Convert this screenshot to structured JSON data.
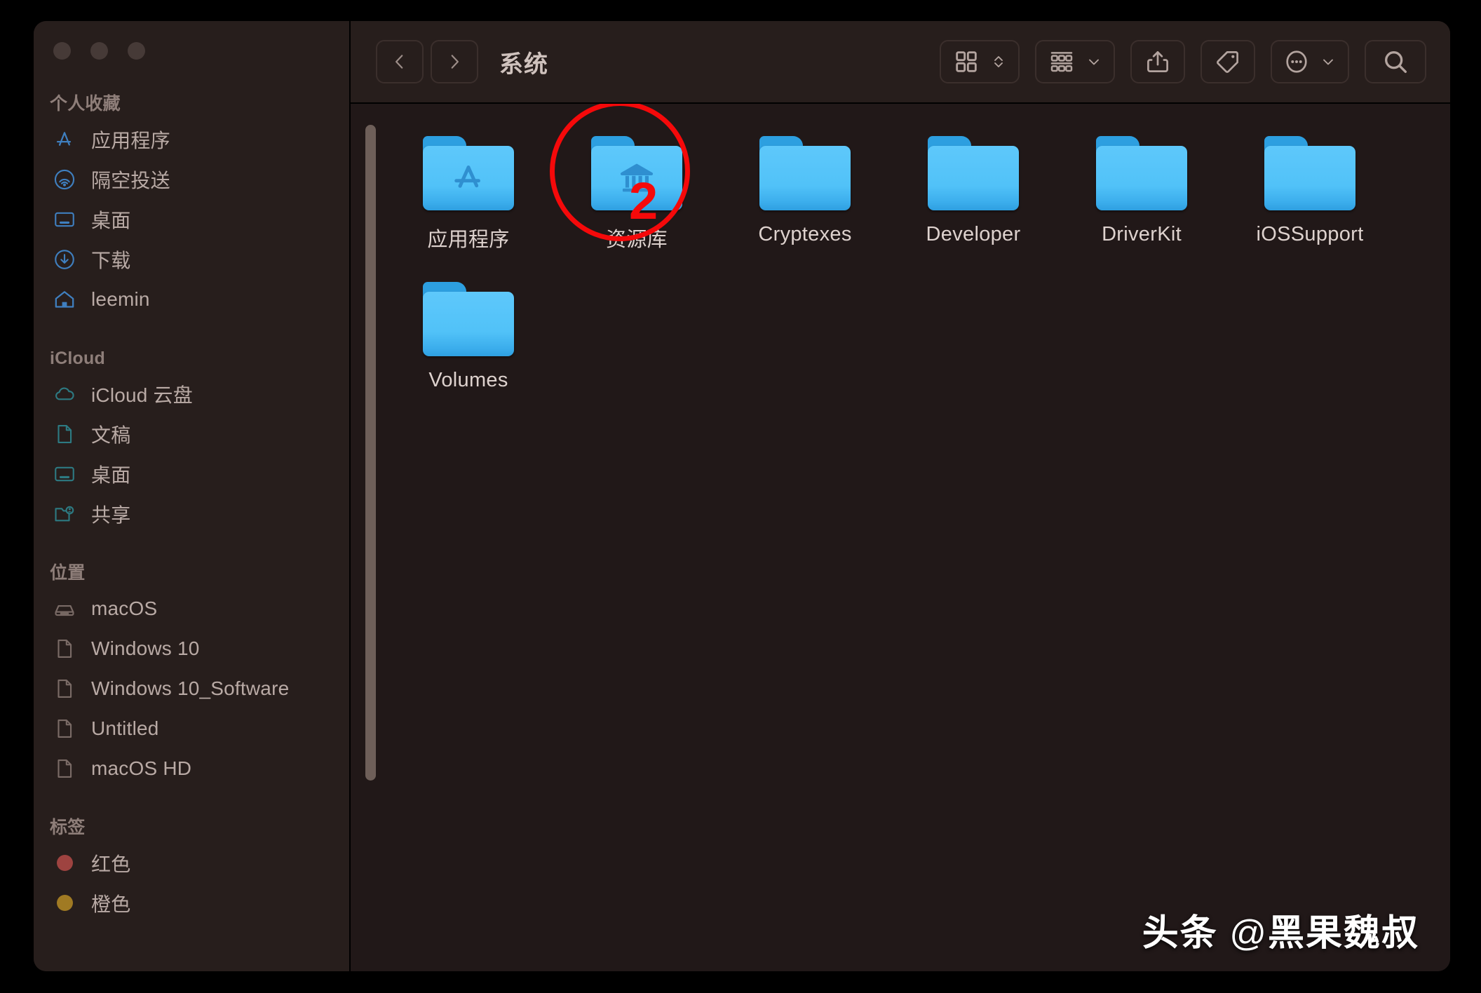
{
  "window": {
    "title": "系统",
    "traffic_lights": [
      "close",
      "minimize",
      "maximize"
    ]
  },
  "toolbar": {
    "back_icon": "chevron-left-icon",
    "forward_icon": "chevron-right-icon",
    "title": "系统",
    "view_icon": "icon-view-grid-icon",
    "view_stepper_icon": "chevron-updown-icon",
    "group_icon": "group-by-list-icon",
    "group_chevron_icon": "chevron-down-icon",
    "share_icon": "share-up-arrow-icon",
    "tag_icon": "tag-icon",
    "more_icon": "ellipsis-circle-icon",
    "more_chevron_icon": "chevron-down-icon",
    "search_icon": "search-icon"
  },
  "sidebar": {
    "sections": [
      {
        "title": "个人收藏",
        "items": [
          {
            "label": "应用程序",
            "icon": "app-store-a-icon",
            "color": "#3f7fbf"
          },
          {
            "label": "隔空投送",
            "icon": "airdrop-icon",
            "color": "#3f7fbf"
          },
          {
            "label": "桌面",
            "icon": "desktop-monitor-icon",
            "color": "#3f7fbf"
          },
          {
            "label": "下载",
            "icon": "download-circle-icon",
            "color": "#3f7fbf"
          },
          {
            "label": "leemin",
            "icon": "home-house-icon",
            "color": "#3f7fbf"
          }
        ]
      },
      {
        "title": "iCloud",
        "items": [
          {
            "label": "iCloud 云盘",
            "icon": "cloud-icon",
            "color": "#2d7a82"
          },
          {
            "label": "文稿",
            "icon": "document-page-icon",
            "color": "#2d7a82"
          },
          {
            "label": "桌面",
            "icon": "desktop-monitor-icon",
            "color": "#2d7a82"
          },
          {
            "label": "共享",
            "icon": "shared-folder-person-icon",
            "color": "#2d7a82"
          }
        ]
      },
      {
        "title": "位置",
        "items": [
          {
            "label": "macOS",
            "icon": "hard-drive-icon",
            "color": "#7a6b66"
          },
          {
            "label": "Windows 10",
            "icon": "document-page-icon",
            "color": "#7a6b66"
          },
          {
            "label": "Windows 10_Software",
            "icon": "document-page-icon",
            "color": "#7a6b66"
          },
          {
            "label": "Untitled",
            "icon": "document-page-icon",
            "color": "#7a6b66"
          },
          {
            "label": "macOS HD",
            "icon": "document-page-icon",
            "color": "#7a6b66"
          }
        ]
      },
      {
        "title": "标签",
        "items": [
          {
            "label": "红色",
            "icon": "tag-dot-icon",
            "color": "#9e4340"
          },
          {
            "label": "橙色",
            "icon": "tag-dot-icon",
            "color": "#a07a23"
          }
        ]
      }
    ]
  },
  "content": {
    "items": [
      {
        "label": "应用程序",
        "icon": "folder-applications-icon",
        "glyph": "appstore"
      },
      {
        "label": "资源库",
        "icon": "folder-library-icon",
        "glyph": "bank"
      },
      {
        "label": "Cryptexes",
        "icon": "folder-icon",
        "glyph": "none"
      },
      {
        "label": "Developer",
        "icon": "folder-icon",
        "glyph": "none"
      },
      {
        "label": "DriverKit",
        "icon": "folder-icon",
        "glyph": "none"
      },
      {
        "label": "iOSSupport",
        "icon": "folder-icon",
        "glyph": "none"
      },
      {
        "label": "Volumes",
        "icon": "folder-icon",
        "glyph": "none"
      }
    ]
  },
  "annotation": {
    "step_number": "2",
    "color": "#f5090a",
    "target_label": "资源库"
  },
  "watermark": {
    "brand": "头条",
    "at": "@",
    "handle": "黑果魏叔"
  }
}
